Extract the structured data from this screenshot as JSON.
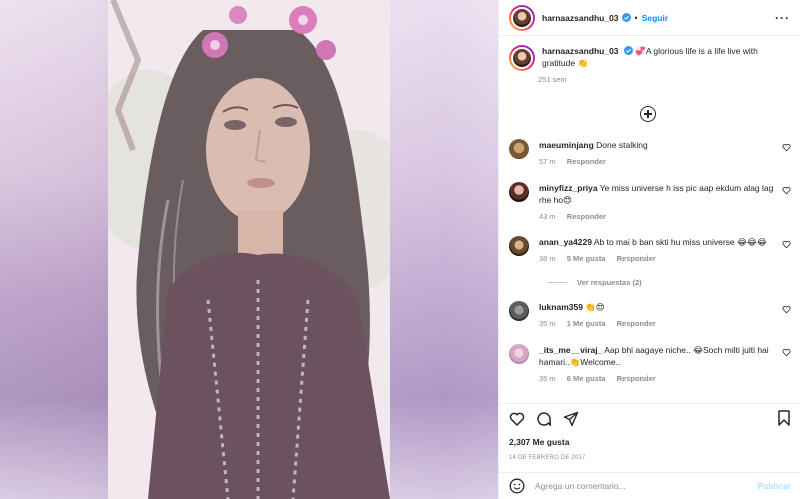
{
  "post": {
    "username": "harnaazsandhu_03",
    "follow_label": "Seguir",
    "caption": "💞A glorious life is a life live with gratitude 👏",
    "caption_age": "251 sem"
  },
  "comments": [
    {
      "user": "maeuminjang",
      "text": "Done stalking",
      "age": "57 m",
      "likes": "",
      "reply": "Responder"
    },
    {
      "user": "minyfizz_priya",
      "text": "Ye miss universe h iss pic aap ekdum alag lag rhe ho😍",
      "age": "43 m",
      "likes": "",
      "reply": "Responder"
    },
    {
      "user": "anan_ya4229",
      "text": "Ab to mai b ban skti hu miss universe 😂😂😂",
      "age": "38 m",
      "likes": "5 Me gusta",
      "reply": "Responder"
    },
    {
      "user": "luknam359",
      "text": "👏😍",
      "age": "35 m",
      "likes": "1 Me gusta",
      "reply": "Responder"
    },
    {
      "user": "_its_me__viraj_",
      "text": "Aap bhi aagaye niche.. 😂Soch milti julti hai hamari..👏Welcome..",
      "age": "35 m",
      "likes": "6 Me gusta",
      "reply": "Responder"
    }
  ],
  "view_replies": "Ver respuestas (2)",
  "likes_count": "2,307 Me gusta",
  "post_date": "14 DE FEBRERO DE 2017",
  "add_comment_placeholder": "Agrega un comentario...",
  "publish_label": "Publicar",
  "colors": {
    "link": "#0095f6",
    "muted": "#8e8e8e",
    "publish_disabled": "#b2dffc"
  }
}
